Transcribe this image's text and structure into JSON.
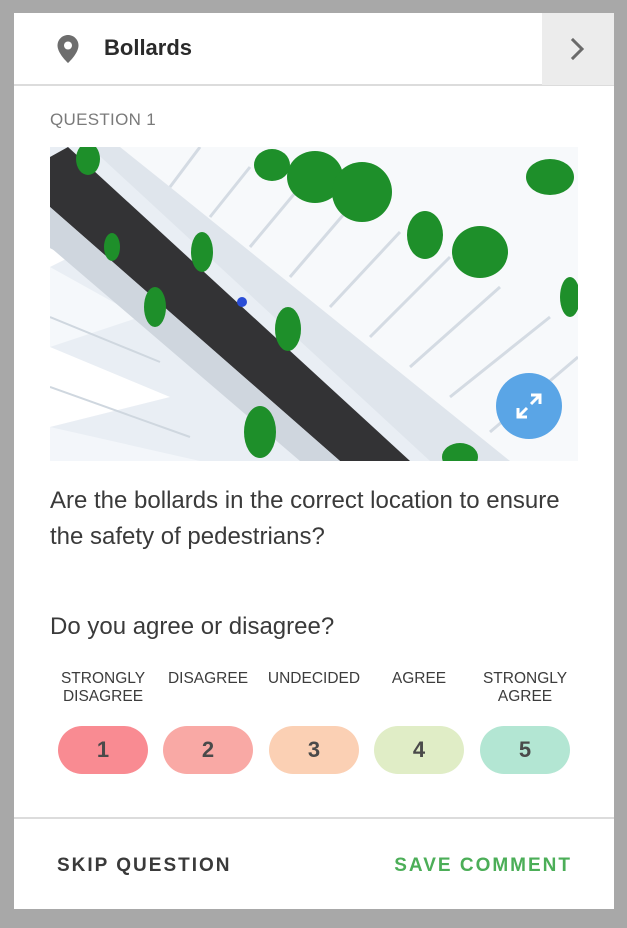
{
  "header": {
    "title": "Bollards",
    "location_icon": "map-pin-icon",
    "next_icon": "chevron-right-icon"
  },
  "question": {
    "number_label": "QUESTION 1",
    "text": "Are the bollards in the correct location to ensure the safety of pedestrians?",
    "expand_icon": "expand-arrows-icon"
  },
  "rating": {
    "prompt": "Do you agree or disagree?",
    "options": [
      {
        "label": "STRONGLY\nDISAGREE",
        "value": "1",
        "color": "#f98b92"
      },
      {
        "label": "DISAGREE",
        "value": "2",
        "color": "#f9a9a5"
      },
      {
        "label": "UNDECIDED",
        "value": "3",
        "color": "#fbd0b4"
      },
      {
        "label": "AGREE",
        "value": "4",
        "color": "#e0edc6"
      },
      {
        "label": "STRONGLY\nAGREE",
        "value": "5",
        "color": "#b3e6d3"
      }
    ]
  },
  "footer": {
    "skip_label": "SKIP QUESTION",
    "save_label": "SAVE COMMENT"
  },
  "colors": {
    "accent_save": "#4cae58",
    "expand_button": "#5aa5e6"
  }
}
